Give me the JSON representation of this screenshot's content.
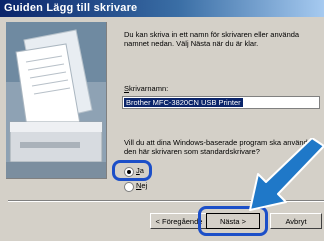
{
  "window": {
    "title": "Guiden Lägg till skrivare"
  },
  "content": {
    "intro": "Du kan skriva in ett namn för skrivaren eller använda namnet nedan. Välj Nästa när du är klar.",
    "name_label": "Skrivarnamn:",
    "name_value": "Brother MFC-3820CN USB Printer",
    "question": "Vill du att dina Windows-baserade program ska använda den här skrivaren som standardskrivare?"
  },
  "options": [
    {
      "label": "Ja",
      "selected": true
    },
    {
      "label": "Nej",
      "selected": false
    }
  ],
  "buttons": {
    "back": "< Föregående",
    "next": "Nästa >",
    "cancel": "Avbryt"
  },
  "colors": {
    "highlight": "#1c4fc8",
    "arrow": "#1f78c8"
  },
  "icons": {
    "sidebar": "printer-illustration",
    "arrow": "pointer-arrow"
  }
}
